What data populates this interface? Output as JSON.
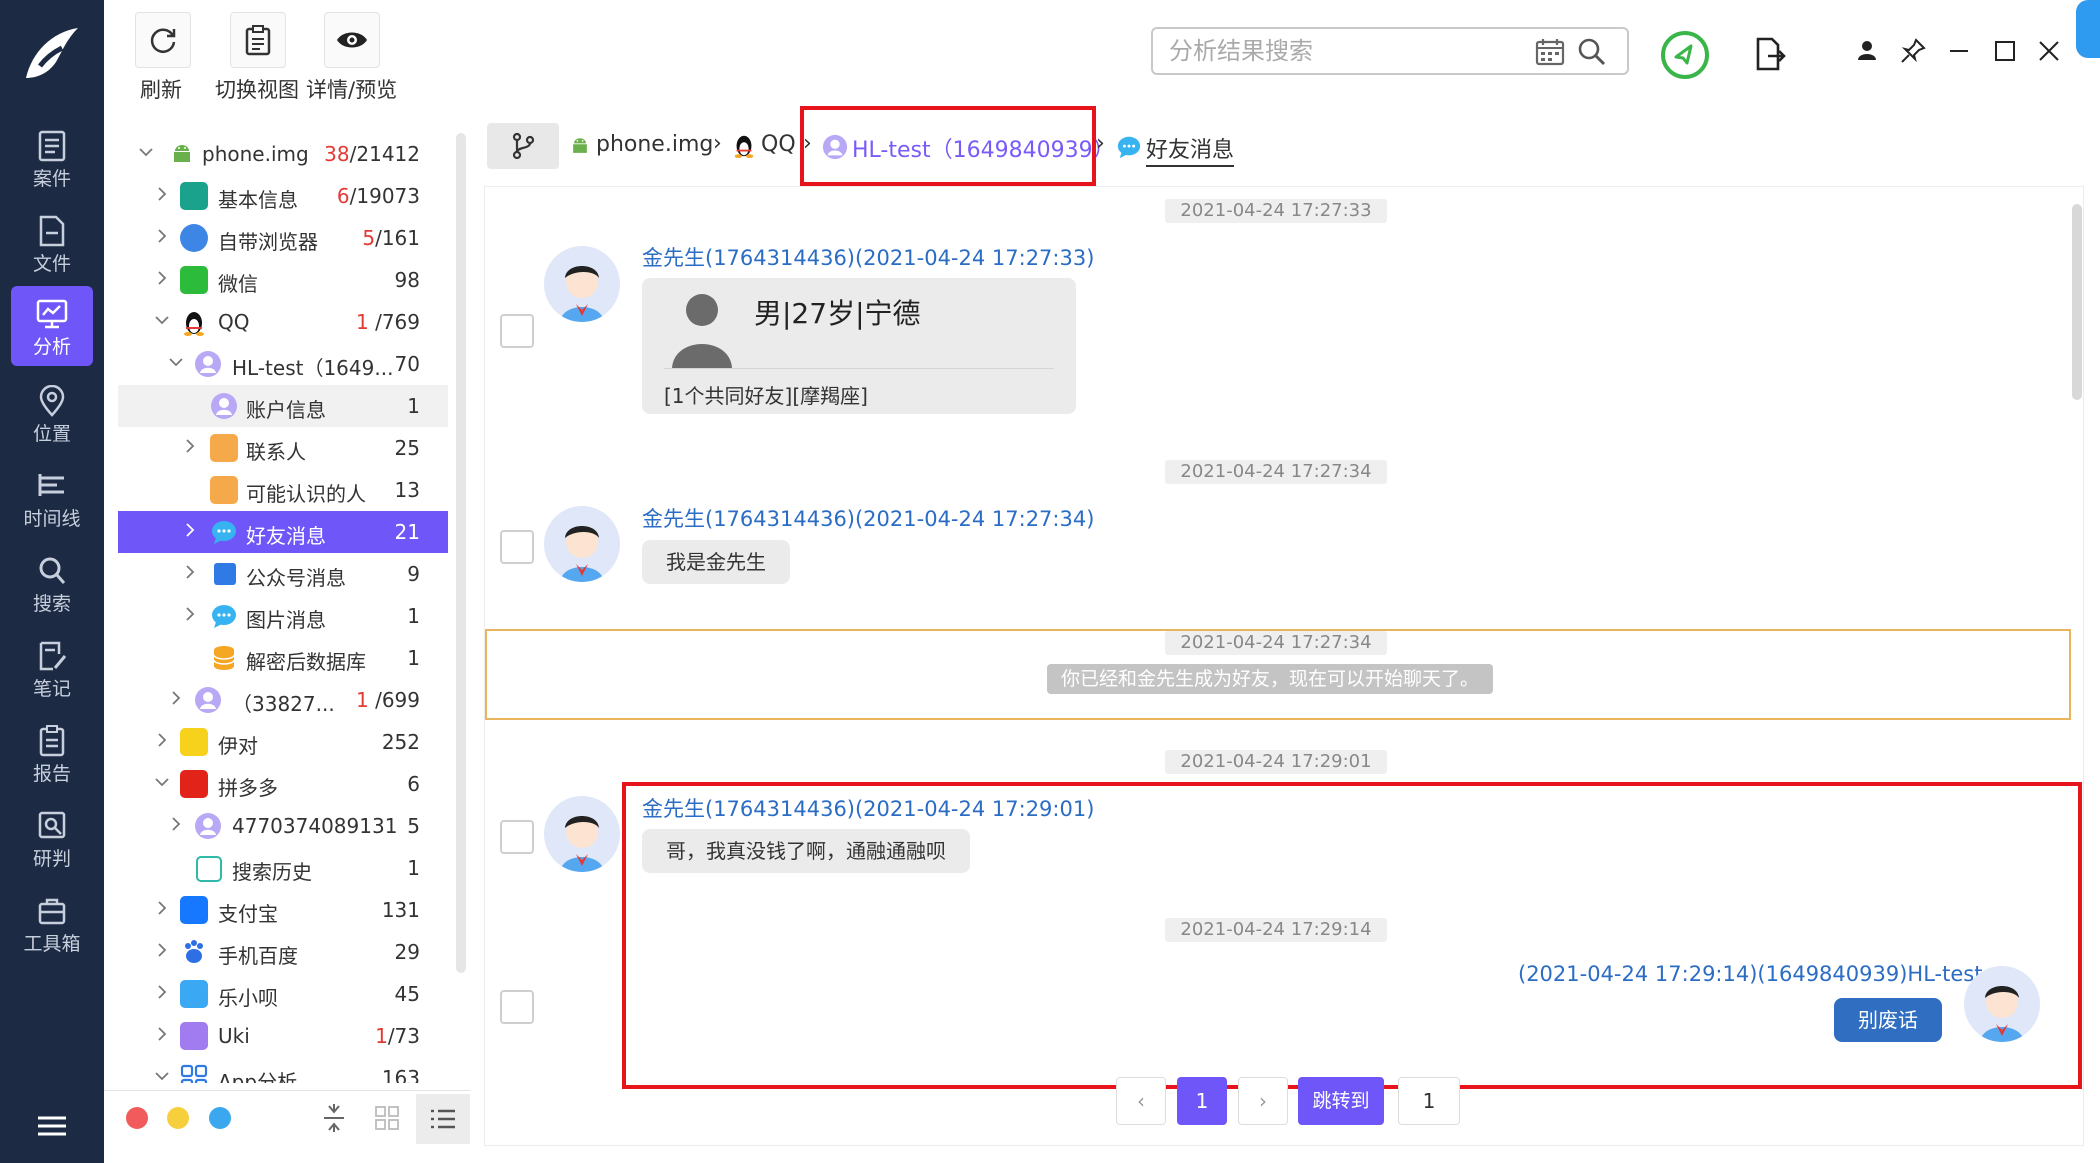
{
  "toolbar": {
    "refresh": "刷新",
    "switch_view": "切换视图",
    "details": "详情/预览"
  },
  "search": {
    "placeholder": "分析结果搜索"
  },
  "nav": {
    "items": [
      {
        "label": "案件"
      },
      {
        "label": "文件"
      },
      {
        "label": "分析"
      },
      {
        "label": "位置"
      },
      {
        "label": "时间线"
      },
      {
        "label": "搜索"
      },
      {
        "label": "笔记"
      },
      {
        "label": "报告"
      },
      {
        "label": "研判"
      },
      {
        "label": "工具箱"
      }
    ],
    "active": "分析"
  },
  "tree": {
    "rows": [
      {
        "label": "phone.img",
        "count_red": "38",
        "count": "/21412"
      },
      {
        "label": "基本信息",
        "count_red": "6",
        "count": "/19073"
      },
      {
        "label": "自带浏览器",
        "count_red": "5",
        "count": "/161"
      },
      {
        "label": "微信",
        "count_red": "",
        "count": "98"
      },
      {
        "label": "QQ",
        "count_red": "1",
        "count": "/769"
      },
      {
        "label": "HL-test（1649...",
        "count_red": "",
        "count": "70"
      },
      {
        "label": "账户信息",
        "count_red": "",
        "count": "1"
      },
      {
        "label": "联系人",
        "count_red": "",
        "count": "25"
      },
      {
        "label": "可能认识的人",
        "count_red": "",
        "count": "13"
      },
      {
        "label": "好友消息",
        "count_red": "",
        "count": "21"
      },
      {
        "label": "公众号消息",
        "count_red": "",
        "count": "9"
      },
      {
        "label": "图片消息",
        "count_red": "",
        "count": "1"
      },
      {
        "label": "解密后数据库",
        "count_red": "",
        "count": "1"
      },
      {
        "label": "（33827...",
        "count_red": "1",
        "count": "/699"
      },
      {
        "label": "伊对",
        "count_red": "",
        "count": "252"
      },
      {
        "label": "拼多多",
        "count_red": "",
        "count": "6"
      },
      {
        "label": "4770374089131",
        "count_red": "",
        "count": "5"
      },
      {
        "label": "搜索历史",
        "count_red": "",
        "count": "1"
      },
      {
        "label": "支付宝",
        "count_red": "",
        "count": "131"
      },
      {
        "label": "手机百度",
        "count_red": "",
        "count": "29"
      },
      {
        "label": "乐小呗",
        "count_red": "",
        "count": "45"
      },
      {
        "label": "Uki",
        "count_red": "1",
        "count": "/73"
      },
      {
        "label": "App分析",
        "count_red": "",
        "count": "163"
      }
    ]
  },
  "breadcrumb": {
    "items": [
      "phone.img",
      "QQ",
      "HL-test（1649840939）",
      "好友消息"
    ]
  },
  "chat": {
    "messages": [
      {
        "time": "2021-04-24 17:27:33",
        "sender": "金先生(1764314436)(2021-04-24 17:27:33)",
        "card_title": "男|27岁|宁德",
        "card_sub": "[1个共同好友][摩羯座]"
      },
      {
        "time": "2021-04-24 17:27:34",
        "sender": "金先生(1764314436)(2021-04-24 17:27:34)",
        "text": "我是金先生"
      },
      {
        "time": "2021-04-24 17:27:34",
        "system": "你已经和金先生成为好友，现在可以开始聊天了。"
      },
      {
        "time": "2021-04-24 17:29:01",
        "sender": "金先生(1764314436)(2021-04-24 17:29:01)",
        "text": "哥，我真没钱了啊，通融通融呗"
      },
      {
        "time": "2021-04-24 17:29:14",
        "sender": "(2021-04-24 17:29:14)(1649840939)HL-test",
        "text": "别废话"
      }
    ]
  },
  "pager": {
    "current": "1",
    "jump_label": "跳转到",
    "jump_value": "1"
  },
  "colors": {
    "accent": "#6e56f8",
    "nav_bg": "#1c2a44",
    "highlight_red": "#e8141c",
    "sender_blue": "#2b6cc4"
  }
}
